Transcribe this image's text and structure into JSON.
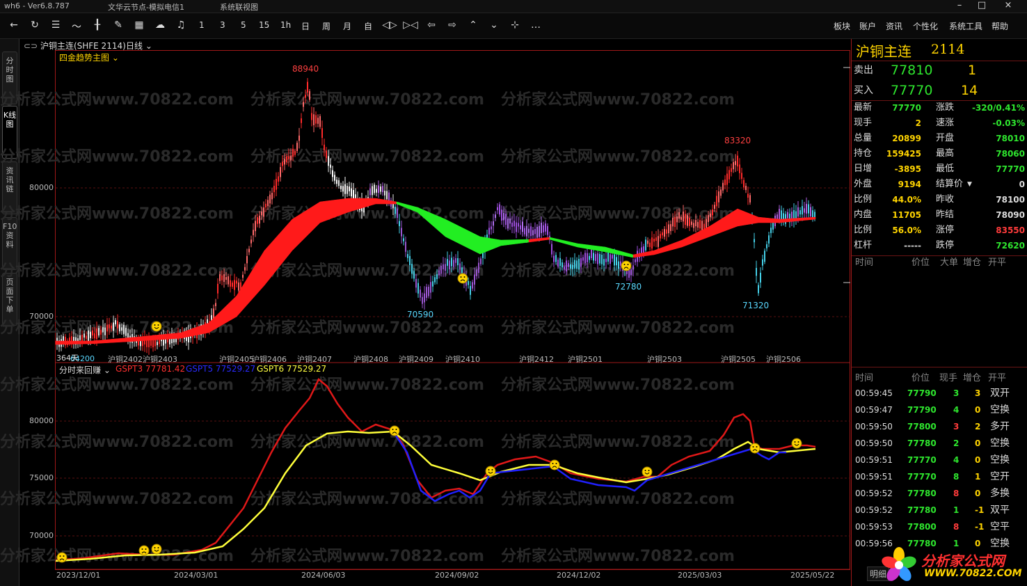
{
  "window": {
    "app": "wh6 - Ver6.8.787",
    "node": "文华云节点-模拟电信1",
    "menu": "系统联视图",
    "controls": [
      "–",
      "□",
      "×"
    ]
  },
  "toolbar": {
    "icons": [
      "back-icon",
      "refresh-icon",
      "list-icon",
      "line-chart-icon",
      "candle-icon",
      "draw-icon",
      "calc-icon",
      "cloud-icon",
      "alarm-icon"
    ],
    "periods": [
      "1",
      "3",
      "5",
      "15",
      "1h",
      "日",
      "周",
      "月",
      "自"
    ],
    "right_menu": [
      "板块",
      "账户",
      "资讯",
      "个性化",
      "系统工具",
      "帮助"
    ]
  },
  "left_tabs": [
    "分时图",
    "K线图",
    "资讯链",
    "F10资料",
    "页面下单"
  ],
  "chart": {
    "symbol_title": "沪铜主连(SHFE 2114)",
    "period": "日线",
    "main_indicator": "四金趋势主图",
    "sub_indicator": "分时来回赚",
    "legend": [
      {
        "text": "GSPT3 77781.42",
        "color": "#ff3030"
      },
      {
        "text": "GSPT5 77529.27",
        "color": "#2a2aff"
      },
      {
        "text": "GSPT6 77529.27",
        "color": "#ffff40"
      }
    ],
    "main_y_ticks": [
      "80000",
      "70000"
    ],
    "sub_y_ticks": [
      "80000",
      "75000",
      "70000"
    ],
    "main_annotations": [
      {
        "text": "88940",
        "color": "#ff4040"
      },
      {
        "text": "70590",
        "color": "#5ad8ff"
      },
      {
        "text": "72780",
        "color": "#5ad8ff"
      },
      {
        "text": "83320",
        "color": "#ff4040"
      },
      {
        "text": "71320",
        "color": "#5ad8ff"
      },
      {
        "text": "64200",
        "color": "#5ad8ff"
      }
    ],
    "day_label": "364天",
    "contract_labels": [
      "沪铜2402",
      "沪铜2403",
      "沪铜2405",
      "沪铜2406",
      "沪铜2407",
      "沪铜2408",
      "沪铜2409",
      "沪铜2410",
      "沪铜2412",
      "沪铜2501",
      "沪铜2503",
      "沪铜2505",
      "沪铜2506"
    ],
    "x_dates": [
      "2023/12/01",
      "2024/03/01",
      "2024/06/03",
      "2024/09/02",
      "2024/12/02",
      "2025/03/03",
      "2025/05/22"
    ],
    "watermark": "分析家公式网www.70822.com"
  },
  "quote": {
    "name": "沪铜主连",
    "code": "2114",
    "ask_label": "卖出",
    "ask_price": "77810",
    "ask_vol": "1",
    "bid_label": "买入",
    "bid_price": "77770",
    "bid_vol": "14",
    "rows": [
      {
        "l1": "最新",
        "v1": "77770",
        "c1": "grn",
        "l2": "涨跌",
        "v2": "-320/0.41%",
        "c2": "grn"
      },
      {
        "l1": "现手",
        "v1": "2",
        "c1": "yel",
        "l2": "速涨",
        "v2": "-0.03%",
        "c2": "grn"
      },
      {
        "l1": "总量",
        "v1": "20899",
        "c1": "yel",
        "l2": "开盘",
        "v2": "78010",
        "c2": "grn"
      },
      {
        "l1": "持仓",
        "v1": "159425",
        "c1": "yel",
        "l2": "最高",
        "v2": "78060",
        "c2": "grn"
      },
      {
        "l1": "日增",
        "v1": "-3895",
        "c1": "yel",
        "l2": "最低",
        "v2": "77770",
        "c2": "grn"
      },
      {
        "l1": "外盘",
        "v1": "9194",
        "c1": "yel",
        "l2": "结算价",
        "v2": "0",
        "c2": "wht"
      },
      {
        "l1": "比例",
        "v1": "44.0%",
        "c1": "yel",
        "l2": "昨收",
        "v2": "78100",
        "c2": "wht"
      },
      {
        "l1": "内盘",
        "v1": "11705",
        "c1": "yel",
        "l2": "昨结",
        "v2": "78090",
        "c2": "wht"
      },
      {
        "l1": "比例",
        "v1": "56.0%",
        "c1": "yel",
        "l2": "涨停",
        "v2": "83550",
        "c2": "red"
      },
      {
        "l1": "杠杆",
        "v1": "-----",
        "c1": "wht",
        "l2": "跌停",
        "v2": "72620",
        "c2": "grn"
      }
    ],
    "bigtrade_headers": [
      "时间",
      "价位",
      "大单",
      "增仓",
      "开平"
    ],
    "tick_headers": [
      "时间",
      "价位",
      "现手",
      "增仓",
      "开平"
    ],
    "ticks": [
      {
        "t": "00:59:45",
        "p": "77790",
        "v": "3",
        "vc": "grn",
        "z": "3",
        "zc": "yel",
        "k": "双开"
      },
      {
        "t": "00:59:47",
        "p": "77790",
        "v": "4",
        "vc": "grn",
        "z": "0",
        "zc": "yel",
        "k": "空换"
      },
      {
        "t": "00:59:50",
        "p": "77800",
        "v": "3",
        "vc": "red",
        "z": "2",
        "zc": "yel",
        "k": "多开"
      },
      {
        "t": "00:59:50",
        "p": "77780",
        "v": "2",
        "vc": "grn",
        "z": "0",
        "zc": "yel",
        "k": "空换"
      },
      {
        "t": "00:59:51",
        "p": "77770",
        "v": "4",
        "vc": "grn",
        "z": "0",
        "zc": "yel",
        "k": "空换"
      },
      {
        "t": "00:59:51",
        "p": "77770",
        "v": "8",
        "vc": "grn",
        "z": "1",
        "zc": "yel",
        "k": "空开"
      },
      {
        "t": "00:59:52",
        "p": "77780",
        "v": "8",
        "vc": "red",
        "z": "0",
        "zc": "yel",
        "k": "多换"
      },
      {
        "t": "00:59:52",
        "p": "77780",
        "v": "1",
        "vc": "grn",
        "z": "-1",
        "zc": "yel",
        "k": "双平"
      },
      {
        "t": "00:59:53",
        "p": "77800",
        "v": "8",
        "vc": "red",
        "z": "-1",
        "zc": "yel",
        "k": "空平"
      },
      {
        "t": "00:59:56",
        "p": "77780",
        "v": "1",
        "vc": "grn",
        "z": "0",
        "zc": "yel",
        "k": "空换"
      }
    ],
    "detail_tab": "明细"
  },
  "logo": {
    "text": "分析家公式网",
    "url": "WWW.70822.COM"
  }
}
